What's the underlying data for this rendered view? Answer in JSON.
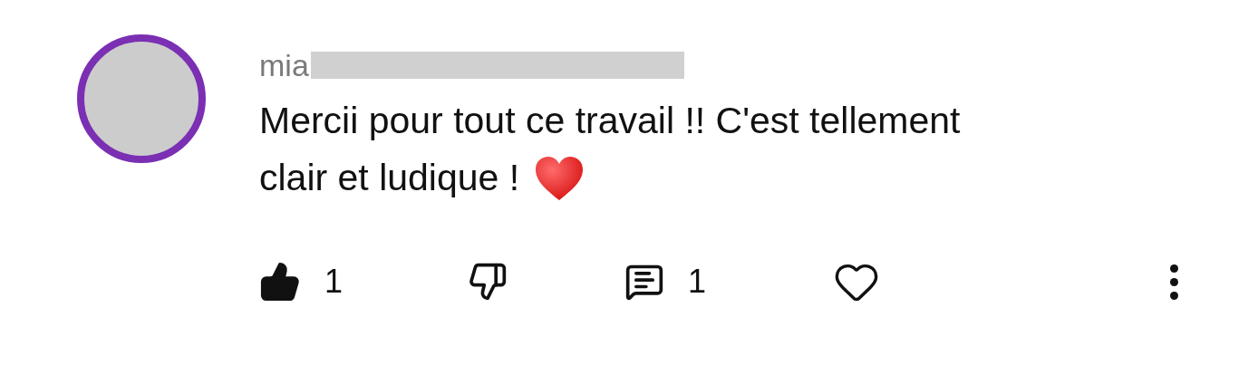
{
  "author": {
    "name": "mia",
    "redacted": true
  },
  "comment": {
    "lines": [
      "Mercii pour tout ce travail !! C'est tellement",
      "clair et ludique !"
    ]
  },
  "actions": [
    {
      "kind": "like",
      "selected": true,
      "count": "1"
    },
    {
      "kind": "dislike",
      "selected": false
    },
    {
      "kind": "reply",
      "count": "1"
    },
    {
      "kind": "love",
      "selected": false
    },
    {
      "kind": "more"
    }
  ]
}
